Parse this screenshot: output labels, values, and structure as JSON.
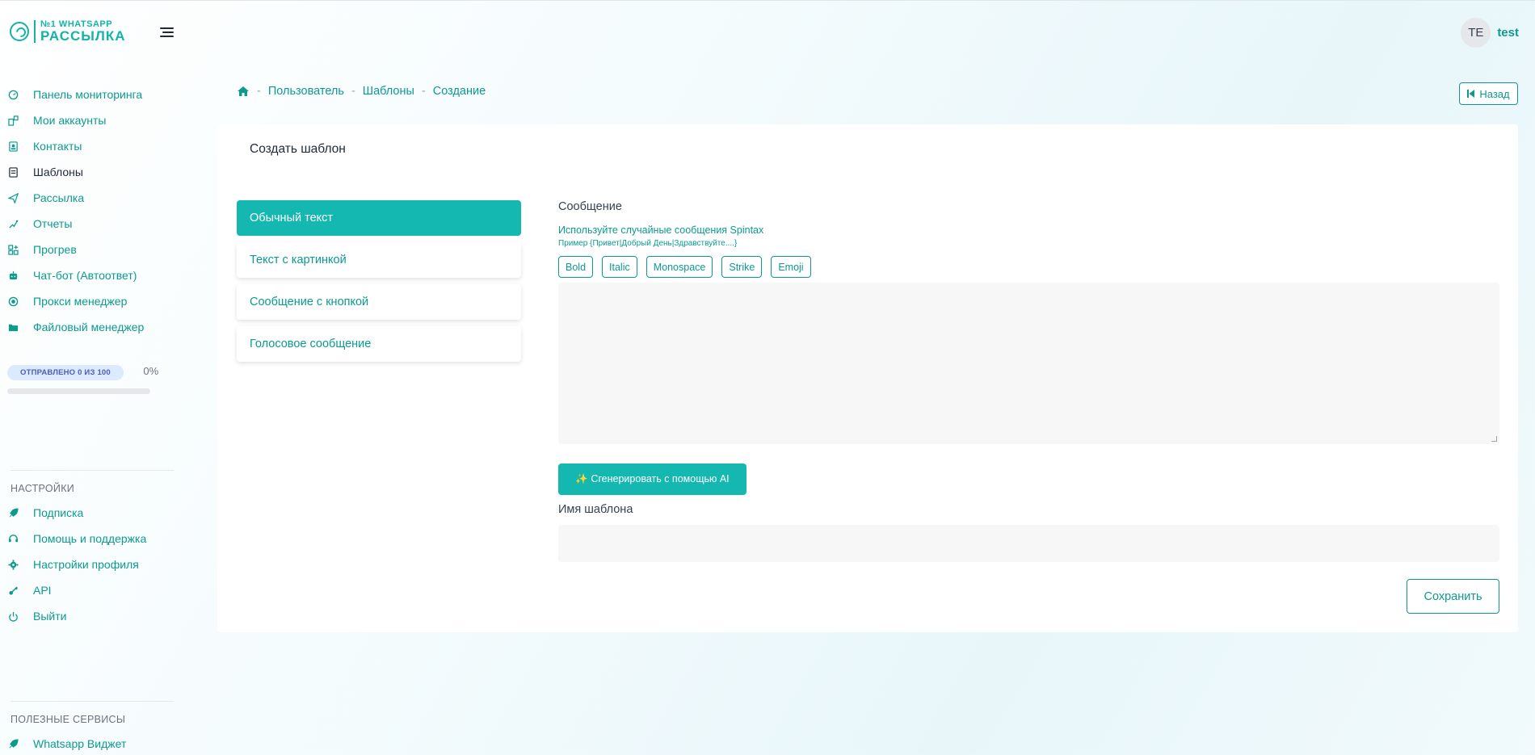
{
  "brand": {
    "logo_top": "№1 WHATSAPP",
    "logo_bottom": "РАССЫЛКА"
  },
  "sidebar": {
    "items": [
      {
        "label": "Панель мониторинга",
        "icon": "gauge-icon"
      },
      {
        "label": "Мои аккаунты",
        "icon": "accounts-icon"
      },
      {
        "label": "Контакты",
        "icon": "contacts-icon"
      },
      {
        "label": "Шаблоны",
        "icon": "templates-icon",
        "active": true
      },
      {
        "label": "Рассылка",
        "icon": "send-icon"
      },
      {
        "label": "Отчеты",
        "icon": "reports-icon"
      },
      {
        "label": "Прогрев",
        "icon": "warmup-icon"
      },
      {
        "label": "Чат-бот (Автоответ)",
        "icon": "bot-icon"
      },
      {
        "label": "Прокси менеджер",
        "icon": "proxy-icon"
      },
      {
        "label": "Файловый менеджер",
        "icon": "folder-icon"
      }
    ],
    "progress": {
      "badge": "ОТПРАВЛЕНО 0 ИЗ 100",
      "percent_text": "0%",
      "fraction": 0
    },
    "settings_title": "НАСТРОЙКИ",
    "settings_items": [
      {
        "label": "Подписка",
        "icon": "subscription-icon"
      },
      {
        "label": "Помощь и поддержка",
        "icon": "headset-icon"
      },
      {
        "label": "Настройки профиля",
        "icon": "gear-icon"
      },
      {
        "label": "API",
        "icon": "api-icon"
      },
      {
        "label": "Выйти",
        "icon": "power-icon"
      }
    ],
    "services_title": "ПОЛЕЗНЫЕ СЕРВИСЫ",
    "services_items": [
      {
        "label": "Whatsapp Виджет",
        "icon": "widget-icon"
      }
    ]
  },
  "user": {
    "initials": "TE",
    "name": "test"
  },
  "breadcrumb": {
    "items": [
      "Пользователь",
      "Шаблоны",
      "Создание"
    ],
    "separator": "-"
  },
  "back_button": "Назад",
  "card": {
    "title": "Создать шаблон",
    "types": [
      "Обычный текст",
      "Текст с картинкой",
      "Сообщение с кнопкой",
      "Голосовое сообщение"
    ],
    "active_type": 0
  },
  "form": {
    "message_label": "Сообщение",
    "hint": "Используйте случайные сообщения Spintax",
    "example": "Пример {Привет|Добрый День|Здравствуйте....}",
    "format_buttons": [
      "Bold",
      "Italic",
      "Monospace",
      "Strike",
      "Emoji"
    ],
    "message_value": "",
    "ai_button": "✨ Сгенерировать с помощью AI",
    "name_label": "Имя шаблона",
    "name_value": "",
    "save_button": "Сохранить"
  },
  "colors": {
    "accent": "#14b8b0",
    "accent_text": "#0c9a90"
  }
}
